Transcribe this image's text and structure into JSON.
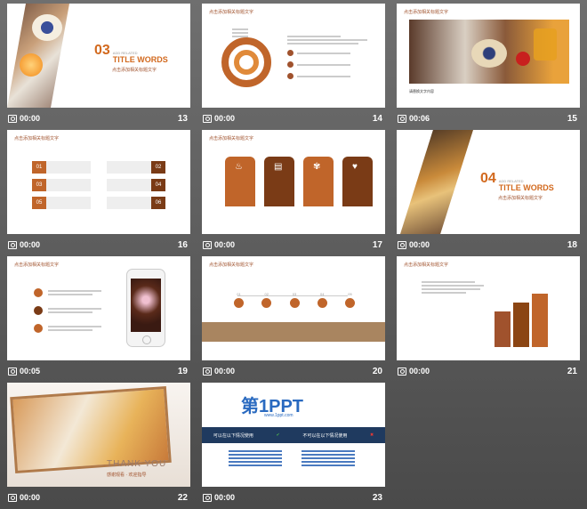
{
  "slides": [
    {
      "num": "13",
      "duration": "00:00",
      "num_label": "03",
      "title": "TITLE WORDS",
      "add_related": "ADD RELATED",
      "subtitle": "点击添加相关标题文字"
    },
    {
      "num": "14",
      "duration": "00:00",
      "header": "点击添加相关标题文字"
    },
    {
      "num": "15",
      "duration": "00:06",
      "header": "点击添加相关标题文字",
      "caption": "请替换文字内容"
    },
    {
      "num": "16",
      "duration": "00:00",
      "header": "点击添加相关标题文字",
      "items": [
        "01",
        "02",
        "03",
        "04",
        "05",
        "06"
      ]
    },
    {
      "num": "17",
      "duration": "00:00",
      "header": "点击添加相关标题文字"
    },
    {
      "num": "18",
      "duration": "00:00",
      "num_label": "04",
      "title": "TITLE WORDS",
      "add_related": "ADD RELATED",
      "subtitle": "点击添加相关标题文字"
    },
    {
      "num": "19",
      "duration": "00:05",
      "header": "点击添加相关标题文字"
    },
    {
      "num": "20",
      "duration": "00:00",
      "header": "点击添加相关标题文字",
      "steps": [
        "01",
        "02",
        "03",
        "04",
        "05"
      ]
    },
    {
      "num": "21",
      "duration": "00:00",
      "header": "点击添加相关标题文字"
    },
    {
      "num": "22",
      "duration": "00:00",
      "thank": "THANK YOU",
      "sub": "感谢观看 · 欢迎指导"
    },
    {
      "num": "23",
      "duration": "00:00",
      "logo_main": "第1PPT",
      "logo_url": "www.1ppt.com",
      "left_head": "可以在以下情况使用",
      "right_head": "不可以在以下情况使用"
    }
  ],
  "colors": {
    "accent": "#a0522d",
    "dark": "#7a3b16",
    "orange": "#d2691e",
    "navy": "#1f3a5f"
  }
}
